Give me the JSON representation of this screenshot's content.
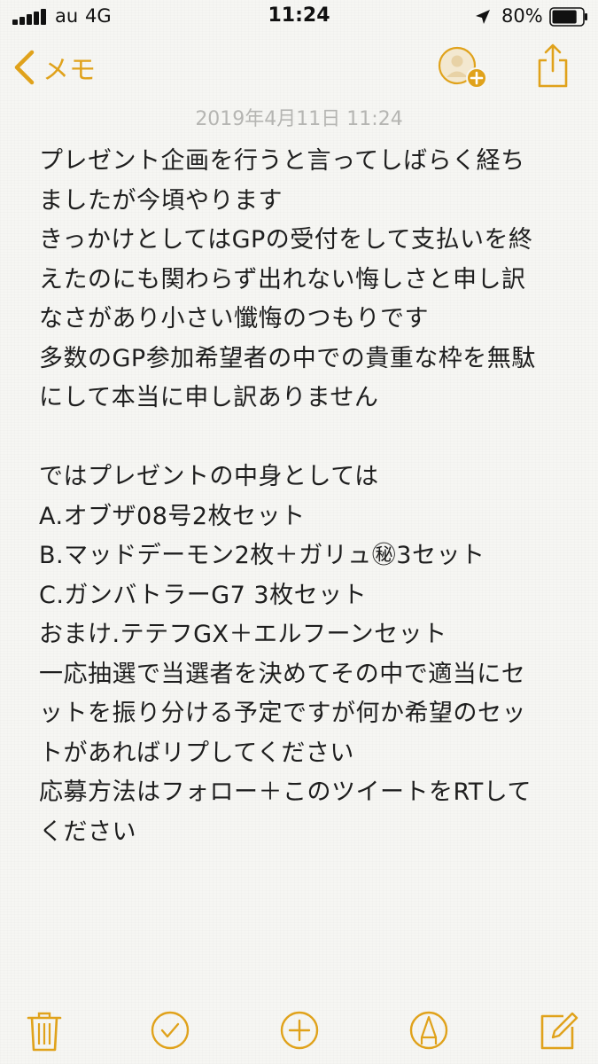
{
  "status_bar": {
    "carrier": "au",
    "network": "4G",
    "time": "11:24",
    "battery": "80%",
    "battery_level": 0.8
  },
  "nav": {
    "back_label": "メモ",
    "accent_color": "#e0a21b"
  },
  "note": {
    "date": "2019年4月11日 11:24",
    "lines": [
      "プレゼント企画を行うと言ってしばらく経ち",
      "ましたが今頃やります",
      "きっかけとしてはGPの受付をして支払いを終",
      "えたのにも関わらず出れない悔しさと申し訳",
      "なさがあり小さい懺悔のつもりです",
      "多数のGP参加希望者の中での貴重な枠を無駄",
      "にして本当に申し訳ありません",
      "",
      "ではプレゼントの中身としては",
      "A.オブザ08号2枚セット",
      "B.マッドデーモン2枚＋ガリュ㊙3セット",
      "C.ガンバトラーG7 3枚セット",
      "おまけ.テテフGX＋エルフーンセット",
      "一応抽選で当選者を決めてその中で適当にセ",
      "ットを振り分ける予定ですが何か希望のセッ",
      "トがあればリプしてください",
      "応募方法はフォロー＋このツイートをRTして",
      "ください"
    ]
  },
  "toolbar": {
    "icons": [
      "trash-icon",
      "checklist-icon",
      "add-icon",
      "markup-icon",
      "compose-icon"
    ]
  }
}
